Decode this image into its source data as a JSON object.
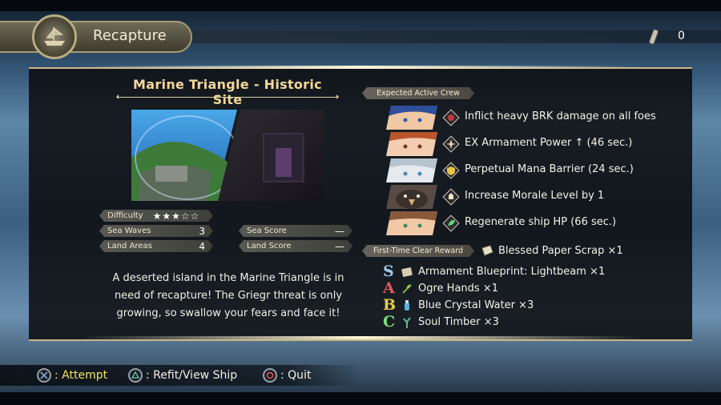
{
  "header": {
    "title": "Recapture",
    "emblem_icon": "ship-emblem-icon",
    "item_icon": "paper-scroll-icon",
    "item_count": "0"
  },
  "site": {
    "title": "Marine Triangle - Historic Site",
    "difficulty_label": "Difficulty",
    "difficulty_stars": "★★★☆☆",
    "difficulty_rating": 3,
    "sea_waves_label": "Sea Waves",
    "sea_waves_value": "3",
    "land_areas_label": "Land Areas",
    "land_areas_value": "4",
    "sea_score_label": "Sea Score",
    "sea_score_value": "—",
    "land_score_label": "Land Score",
    "land_score_value": "—",
    "description": "A deserted island in the Marine Triangle is in need of recapture! The Griegr threat is only growing, so swallow your fears and face it!"
  },
  "crew": {
    "label": "Expected Active Crew",
    "members": [
      {
        "skill": "Inflict heavy BRK damage on all foes",
        "icon": "break-skill-icon",
        "color": "#c03a3a"
      },
      {
        "skill": "EX Armament Power ↑ (46 sec.)",
        "icon": "armament-skill-icon",
        "color": "#e8d9b0"
      },
      {
        "skill": "Perpetual Mana Barrier (24 sec.)",
        "icon": "barrier-skill-icon",
        "color": "#e7c54a"
      },
      {
        "skill": "Increase Morale Level by 1",
        "icon": "morale-skill-icon",
        "color": "#f0e6c8"
      },
      {
        "skill": "Regenerate ship HP (66 sec.)",
        "icon": "heal-skill-icon",
        "color": "#5fd57e"
      }
    ]
  },
  "rewards": {
    "label": "First-Time Clear Reward",
    "first_time": "Blessed Paper Scrap ×1",
    "first_time_icon": "paper-scrap-icon",
    "items": [
      {
        "grade": "S",
        "grade_color": "#9ec8e8",
        "icon": "blueprint-icon",
        "text": "Armament Blueprint: Lightbeam ×1"
      },
      {
        "grade": "A",
        "grade_color": "#e05a5a",
        "icon": "herb-icon",
        "text": "Ogre Hands ×1"
      },
      {
        "grade": "B",
        "grade_color": "#e8c84a",
        "icon": "potion-icon",
        "text": "Blue Crystal Water ×3"
      },
      {
        "grade": "C",
        "grade_color": "#7ee07e",
        "icon": "timber-icon",
        "text": "Soul Timber ×3"
      }
    ]
  },
  "controls": {
    "attempt": ": Attempt",
    "refit": ": Refit/View Ship",
    "quit": ": Quit",
    "attempt_color": "#f2e35a"
  }
}
